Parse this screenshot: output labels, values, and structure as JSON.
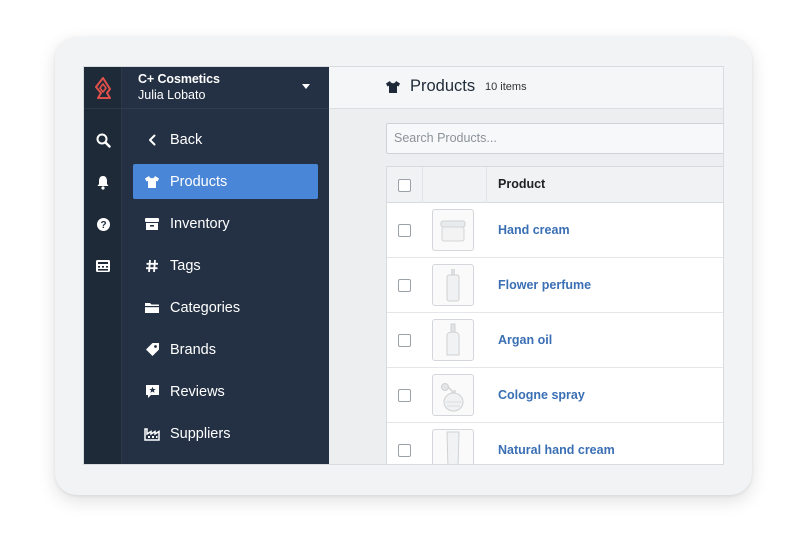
{
  "app": {
    "store_name": "C+ Cosmetics",
    "user_name": "Julia Lobato"
  },
  "rail": {
    "icons": [
      "search-icon",
      "bell-icon",
      "help-icon",
      "register-icon"
    ]
  },
  "nav": {
    "back_label": "Back",
    "items": [
      {
        "label": "Products",
        "icon": "shirt-icon",
        "active": true
      },
      {
        "label": "Inventory",
        "icon": "inventory-icon",
        "active": false
      },
      {
        "label": "Tags",
        "icon": "hash-icon",
        "active": false
      },
      {
        "label": "Categories",
        "icon": "folder-icon",
        "active": false
      },
      {
        "label": "Brands",
        "icon": "tag-icon",
        "active": false
      },
      {
        "label": "Reviews",
        "icon": "star-icon",
        "active": false
      },
      {
        "label": "Suppliers",
        "icon": "factory-icon",
        "active": false
      }
    ]
  },
  "header": {
    "title": "Products",
    "count": "10 items"
  },
  "search": {
    "placeholder": "Search Products..."
  },
  "table": {
    "column": "Product",
    "rows": [
      {
        "name": "Hand cream",
        "thumb": "jar"
      },
      {
        "name": "Flower perfume",
        "thumb": "bottle"
      },
      {
        "name": "Argan oil",
        "thumb": "dropper"
      },
      {
        "name": "Cologne spray",
        "thumb": "atomizer"
      },
      {
        "name": "Natural hand cream",
        "thumb": "tube"
      }
    ]
  },
  "colors": {
    "accent": "#4a86d8",
    "sidebar": "#243144",
    "rail": "#1f2a38",
    "link": "#3a6fb4",
    "logo": "#e0504a"
  }
}
